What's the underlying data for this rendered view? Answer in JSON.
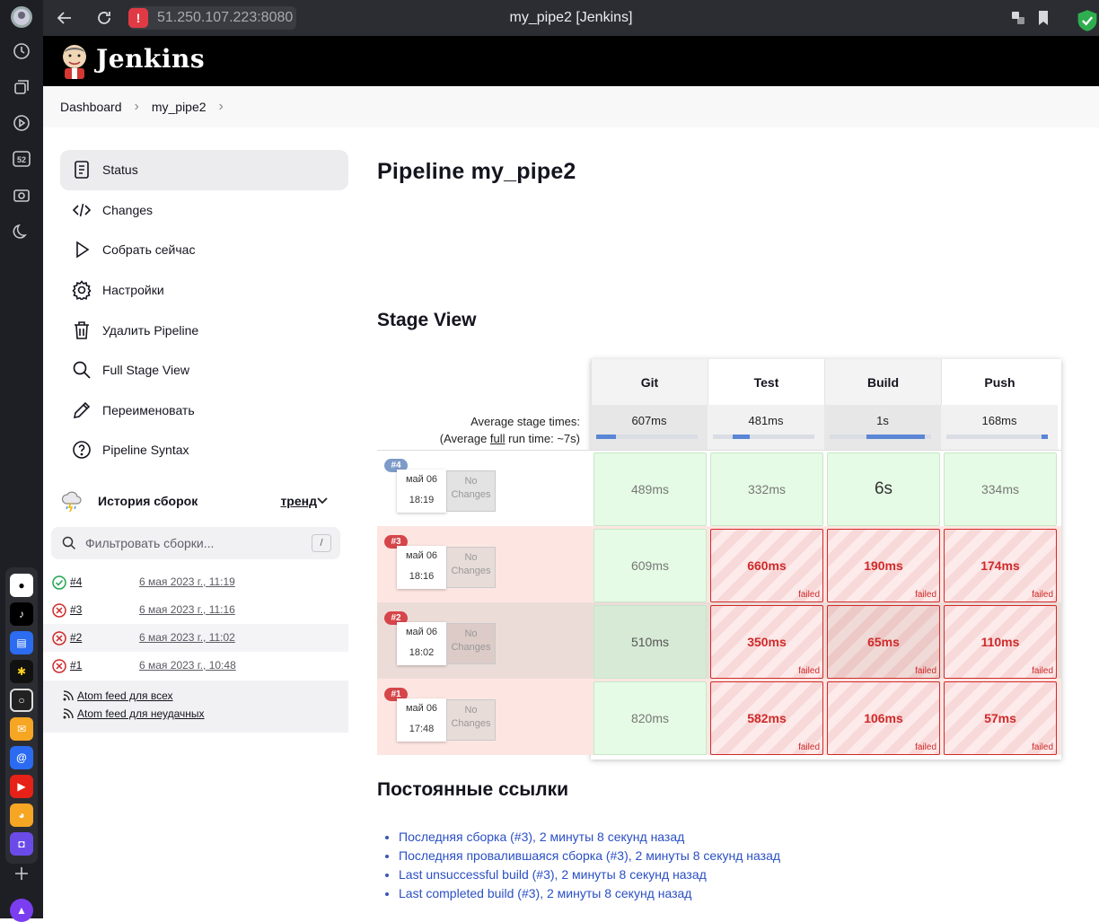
{
  "browser": {
    "url": "51.250.107.223:8080",
    "window_title": "my_pipe2 [Jenkins]"
  },
  "header": {
    "brand": "Jenkins"
  },
  "breadcrumb": [
    "Dashboard",
    "my_pipe2"
  ],
  "sidebar": {
    "tasks": [
      {
        "label": "Status",
        "icon": "status-icon"
      },
      {
        "label": "Changes",
        "icon": "code-icon"
      },
      {
        "label": "Собрать сейчас",
        "icon": "play-icon"
      },
      {
        "label": "Настройки",
        "icon": "gear-icon"
      },
      {
        "label": "Удалить Pipeline",
        "icon": "trash-icon"
      },
      {
        "label": "Full Stage View",
        "icon": "search-icon"
      },
      {
        "label": "Переименовать",
        "icon": "pencil-icon"
      },
      {
        "label": "Pipeline Syntax",
        "icon": "help-icon"
      }
    ],
    "history": {
      "title": "История сборок",
      "trend": "тренд",
      "filter_placeholder": "Фильтровать сборки...",
      "filter_shortcut": "/",
      "builds": [
        {
          "num": "#4",
          "date": "6 мая 2023 г., 11:19",
          "status": "success"
        },
        {
          "num": "#3",
          "date": "6 мая 2023 г., 11:16",
          "status": "failed"
        },
        {
          "num": "#2",
          "date": "6 мая 2023 г., 11:02",
          "status": "failed"
        },
        {
          "num": "#1",
          "date": "6 мая 2023 г., 10:48",
          "status": "failed"
        }
      ],
      "feed_all": "Atom feed для всех",
      "feed_failed": "Atom feed для неудачных"
    }
  },
  "main": {
    "title": "Pipeline my_pipe2",
    "stage_view_title": "Stage View",
    "avg_label_1": "Average stage times:",
    "avg_label_2_prefix": "(Average ",
    "avg_label_2_link": "full",
    "avg_label_2_suffix": " run time: ~7s)",
    "stages": [
      "Git",
      "Test",
      "Build",
      "Push"
    ],
    "avg_times": [
      "607ms",
      "481ms",
      "1s",
      "168ms"
    ],
    "runs": [
      {
        "badge": "#4",
        "date": "май 06",
        "time": "18:19",
        "changes_1": "No",
        "changes_2": "Changes",
        "cells": [
          {
            "t": "489ms",
            "s": "ok"
          },
          {
            "t": "332ms",
            "s": "ok"
          },
          {
            "t": "6s",
            "s": "ok"
          },
          {
            "t": "334ms",
            "s": "ok"
          }
        ]
      },
      {
        "badge": "#3",
        "date": "май 06",
        "time": "18:16",
        "changes_1": "No",
        "changes_2": "Changes",
        "cells": [
          {
            "t": "609ms",
            "s": "ok"
          },
          {
            "t": "660ms",
            "s": "fail"
          },
          {
            "t": "190ms",
            "s": "fail"
          },
          {
            "t": "174ms",
            "s": "fail"
          }
        ]
      },
      {
        "badge": "#2",
        "date": "май 06",
        "time": "18:02",
        "changes_1": "No",
        "changes_2": "Changes",
        "cells": [
          {
            "t": "510ms",
            "s": "ok"
          },
          {
            "t": "350ms",
            "s": "fail"
          },
          {
            "t": "65ms",
            "s": "fail"
          },
          {
            "t": "110ms",
            "s": "fail"
          }
        ]
      },
      {
        "badge": "#1",
        "date": "май 06",
        "time": "17:48",
        "changes_1": "No",
        "changes_2": "Changes",
        "cells": [
          {
            "t": "820ms",
            "s": "ok"
          },
          {
            "t": "582ms",
            "s": "fail"
          },
          {
            "t": "106ms",
            "s": "fail"
          },
          {
            "t": "57ms",
            "s": "fail"
          }
        ]
      }
    ],
    "failed_label": "failed",
    "permalinks_title": "Постоянные ссылки",
    "permalinks": [
      "Последняя сборка (#3), 2 минуты 8 секунд назад",
      "Последняя провалившаяся сборка (#3), 2 минуты 8 секунд назад",
      "Last unsuccessful build (#3), 2 минуты 8 секунд назад",
      "Last completed build (#3), 2 минуты 8 секунд назад"
    ]
  },
  "colors": {
    "success": "#1ea64b",
    "failed": "#d02a2a",
    "stage_ok": "#e5fbe5",
    "accent_link": "#2a4fc4"
  }
}
